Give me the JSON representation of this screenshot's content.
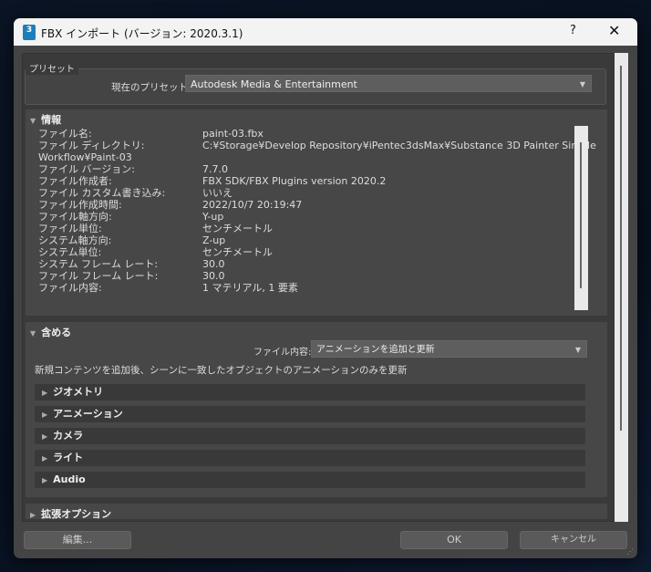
{
  "window": {
    "title": "FBX インポート (バージョン: 2020.3.1)",
    "app_icon_label": "3",
    "help": "?",
    "close": "✕"
  },
  "preset": {
    "group_label": "プリセット",
    "current_label": "現在のプリセット:",
    "current_value": "Autodesk Media & Entertainment"
  },
  "info": {
    "title": "情報",
    "rows": [
      {
        "label": "ファイル名:",
        "value": "paint-03.fbx"
      },
      {
        "label": "ファイル ディレクトリ:",
        "value": "C:¥Storage¥Develop Repository¥iPentec3dsMax¥Substance 3D Painter Simple",
        "cont": "Workflow¥Paint-03"
      },
      {
        "label": "ファイル バージョン:",
        "value": "7.7.0"
      },
      {
        "label": "ファイル作成者:",
        "value": "FBX SDK/FBX Plugins version 2020.2"
      },
      {
        "label": "ファイル カスタム書き込み:",
        "value": "いいえ"
      },
      {
        "label": "ファイル作成時間:",
        "value": "2022/10/7  20:19:47"
      },
      {
        "label": "ファイル軸方向:",
        "value": "Y-up"
      },
      {
        "label": "ファイル単位:",
        "value": "センチメートル"
      },
      {
        "label": "システム軸方向:",
        "value": "Z-up"
      },
      {
        "label": "システム単位:",
        "value": "センチメートル"
      },
      {
        "label": "システム フレーム レート:",
        "value": "30.0"
      },
      {
        "label": "ファイル フレーム レート:",
        "value": "30.0"
      },
      {
        "label": "ファイル内容:",
        "value": "1 マテリアル,  1 要素"
      }
    ]
  },
  "include": {
    "title": "含める",
    "content_label": "ファイル内容:",
    "content_value": "アニメーションを追加と更新",
    "description": "新規コンテンツを追加後、シーンに一致したオブジェクトのアニメーションのみを更新",
    "subsections": [
      "ジオメトリ",
      "アニメーション",
      "カメラ",
      "ライト",
      "Audio"
    ]
  },
  "advanced": {
    "title": "拡張オプション"
  },
  "buttons": {
    "edit": "編集...",
    "ok": "OK",
    "cancel": "キャンセル"
  }
}
